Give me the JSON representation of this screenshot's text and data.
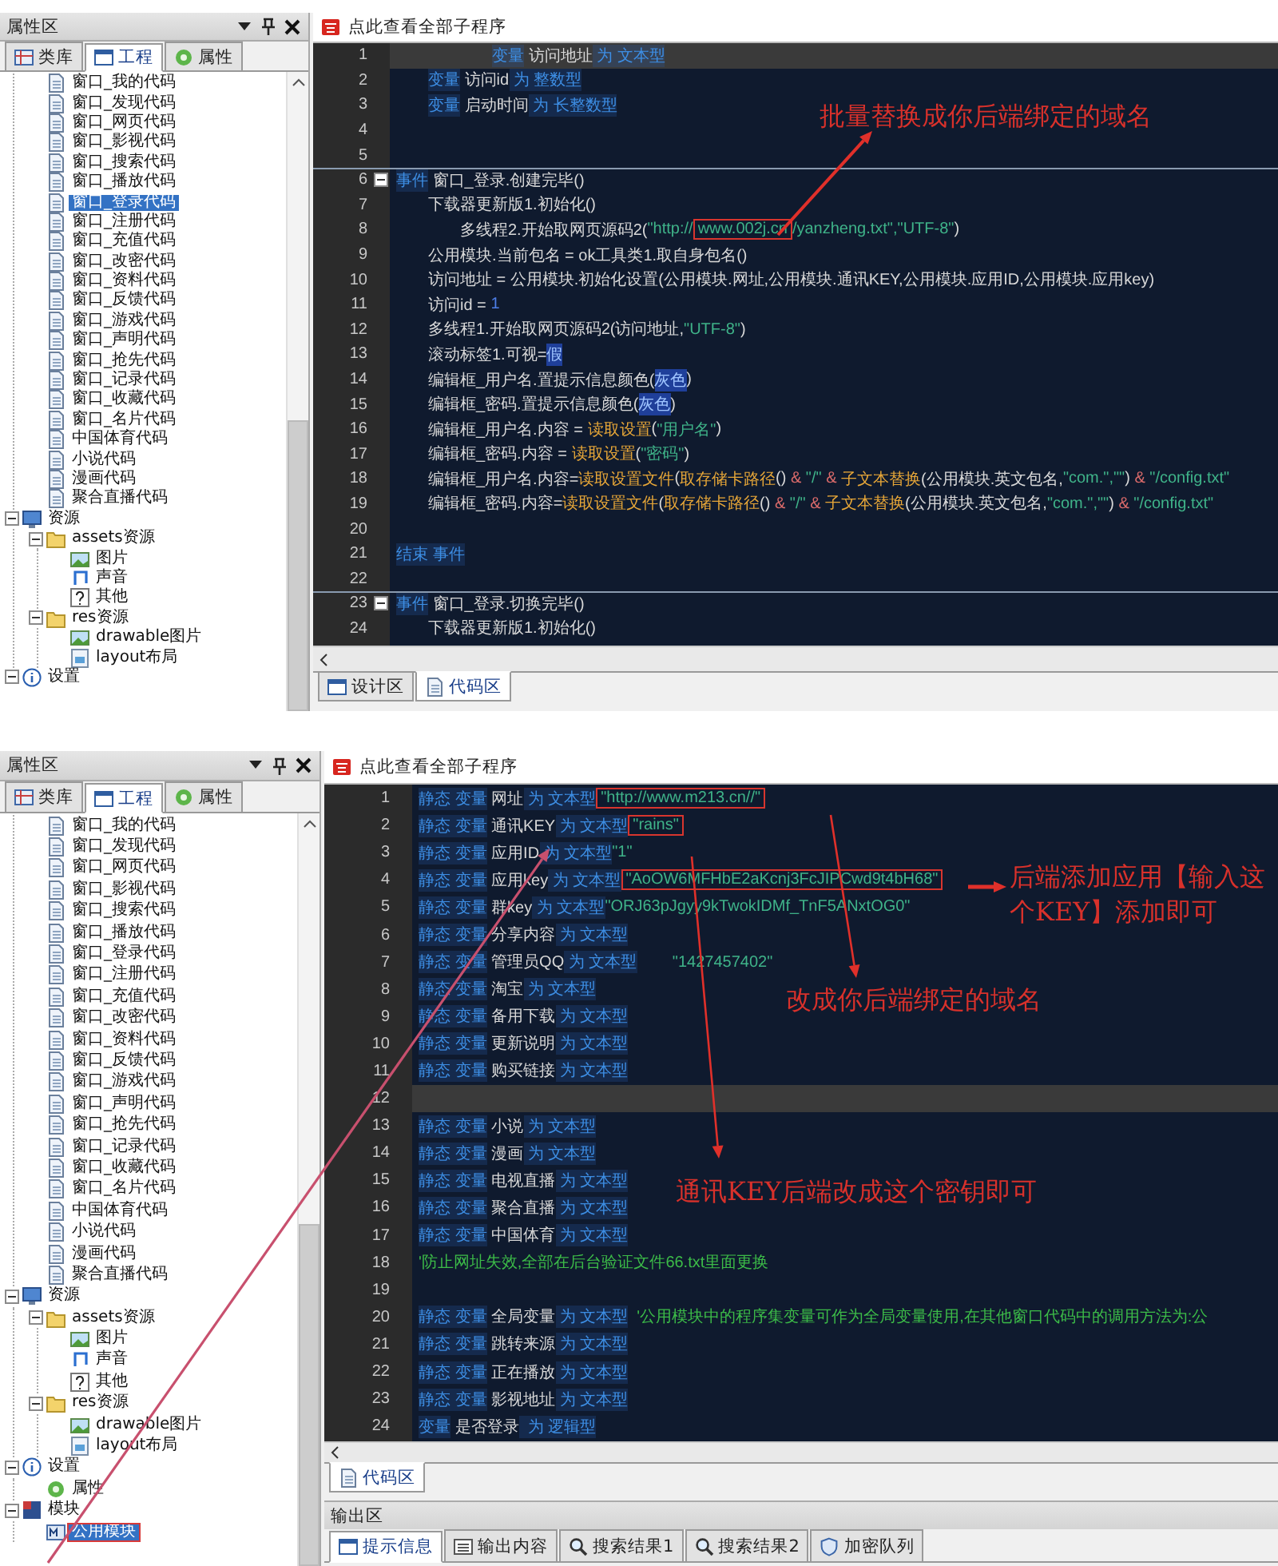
{
  "shots": [
    {
      "sidebar": {
        "title": "属性区",
        "tabs": [
          {
            "label": "类库",
            "kind": "library",
            "selected": false
          },
          {
            "label": "工程",
            "kind": "project",
            "selected": true
          },
          {
            "label": "属性",
            "kind": "property",
            "selected": false
          }
        ],
        "tree": [
          {
            "kind": "continued",
            "children": [
              {
                "label": "窗口_我的代码",
                "kind": "file",
                "selected": false
              },
              {
                "label": "窗口_发现代码",
                "kind": "file",
                "selected": false
              },
              {
                "label": "窗口_网页代码",
                "kind": "file",
                "selected": false
              },
              {
                "label": "窗口_影视代码",
                "kind": "file",
                "selected": false
              },
              {
                "label": "窗口_搜索代码",
                "kind": "file",
                "selected": false
              },
              {
                "label": "窗口_播放代码",
                "kind": "file",
                "selected": false
              },
              {
                "label": "窗口_登录代码",
                "kind": "file",
                "selected": true
              },
              {
                "label": "窗口_注册代码",
                "kind": "file",
                "selected": false
              },
              {
                "label": "窗口_充值代码",
                "kind": "file",
                "selected": false
              },
              {
                "label": "窗口_改密代码",
                "kind": "file",
                "selected": false
              },
              {
                "label": "窗口_资料代码",
                "kind": "file",
                "selected": false
              },
              {
                "label": "窗口_反馈代码",
                "kind": "file",
                "selected": false
              },
              {
                "label": "窗口_游戏代码",
                "kind": "file",
                "selected": false
              },
              {
                "label": "窗口_声明代码",
                "kind": "file",
                "selected": false
              },
              {
                "label": "窗口_抢先代码",
                "kind": "file",
                "selected": false
              },
              {
                "label": "窗口_记录代码",
                "kind": "file",
                "selected": false
              },
              {
                "label": "窗口_收藏代码",
                "kind": "file",
                "selected": false
              },
              {
                "label": "窗口_名片代码",
                "kind": "file",
                "selected": false
              },
              {
                "label": "中国体育代码",
                "kind": "file",
                "selected": false
              },
              {
                "label": "小说代码",
                "kind": "file",
                "selected": false
              },
              {
                "label": "漫画代码",
                "kind": "file",
                "selected": false
              },
              {
                "label": "聚合直播代码",
                "kind": "file",
                "selected": false
              }
            ]
          },
          {
            "label": "资源",
            "kind": "resources",
            "selected": false,
            "expanded": true,
            "children": [
              {
                "label": "assets资源",
                "kind": "folder",
                "selected": false,
                "expanded": true,
                "children": [
                  {
                    "label": "图片",
                    "kind": "image",
                    "selected": false
                  },
                  {
                    "label": "声音",
                    "kind": "sound",
                    "selected": false
                  },
                  {
                    "label": "其他",
                    "kind": "other",
                    "selected": false
                  }
                ]
              },
              {
                "label": "res资源",
                "kind": "folder",
                "selected": false,
                "expanded": true,
                "children": [
                  {
                    "label": "drawable图片",
                    "kind": "image",
                    "selected": false
                  },
                  {
                    "label": "layout布局",
                    "kind": "layout",
                    "selected": false
                  }
                ]
              }
            ]
          },
          {
            "label": "设置",
            "kind": "settings",
            "selected": false,
            "expanded": true
          }
        ]
      },
      "editor": {
        "header": "点此查看全部子程序",
        "lines": [
          {
            "kind": "continued",
            "children": [
              {
                "kind": "continued",
                "children": [
                  {
                    "kind": "continued",
                    "children": [
                      {
                        "n": "1",
                        "current": true,
                        "tokens": [
                          {
                            "kind": "kw",
                            "text": "变量"
                          },
                          {
                            "kind": "id",
                            "text": " 访问地址"
                          },
                          {
                            "kind": "kw",
                            "text": " 为"
                          },
                          {
                            "kind": "kw",
                            "text": " 文本型"
                          }
                        ]
                      }
                    ]
                  }
                ]
              },
              {
                "n": "2",
                "tokens": [
                  {
                    "kind": "kw",
                    "text": "变量"
                  },
                  {
                    "kind": "id",
                    "text": " 访问id"
                  },
                  {
                    "kind": "kw",
                    "text": " 为"
                  },
                  {
                    "kind": "kw",
                    "text": " 整数型"
                  }
                ]
              },
              {
                "n": "3",
                "tokens": [
                  {
                    "kind": "kw",
                    "text": "变量"
                  },
                  {
                    "kind": "id",
                    "text": " 启动时间"
                  },
                  {
                    "kind": "kw",
                    "text": " 为"
                  },
                  {
                    "kind": "kw",
                    "text": " 长整数型"
                  }
                ]
              },
              {
                "n": "4"
              },
              {
                "n": "5"
              }
            ]
          },
          {
            "n": "6",
            "kind": "event",
            "expanded": true,
            "tokens": [
              {
                "kind": "kw",
                "text": "事件"
              },
              {
                "kind": "id",
                "text": " 窗口_登录.创建完毕()"
              }
            ],
            "children": [
              {
                "n": "7",
                "tokens": [
                  {
                    "kind": "id",
                    "text": "下载器更新版1.初始化()"
                  }
                ],
                "children": [
                  {
                    "n": "8",
                    "tokens": [
                      {
                        "kind": "id",
                        "text": "多线程2.开始取网页源码2("
                      },
                      {
                        "kind": "str",
                        "text": "\"http://"
                      },
                      {
                        "kind": "str",
                        "text": "www.002j.cn",
                        "boxed": true
                      },
                      {
                        "kind": "str",
                        "text": "/yanzheng.txt\",\"UTF-8\""
                      },
                      {
                        "kind": "id",
                        "text": ")"
                      }
                    ]
                  }
                ]
              },
              {
                "n": "9",
                "tokens": [
                  {
                    "kind": "id",
                    "text": "公用模块.当前包名 = ok工具类1.取自身包名()"
                  }
                ]
              },
              {
                "n": "10",
                "tokens": [
                  {
                    "kind": "id",
                    "text": "访问地址 = 公用模块.初始化设置(公用模块.网址,公用模块.通讯KEY,公用模块.应用ID,公用模块.应用key)"
                  }
                ]
              },
              {
                "n": "11",
                "tokens": [
                  {
                    "kind": "id",
                    "text": "访问id = "
                  },
                  {
                    "kind": "num",
                    "text": "1"
                  }
                ]
              },
              {
                "n": "12",
                "tokens": [
                  {
                    "kind": "id",
                    "text": "多线程1.开始取网页源码2(访问地址,"
                  },
                  {
                    "kind": "str",
                    "text": "\"UTF-8\""
                  },
                  {
                    "kind": "id",
                    "text": ")"
                  }
                ]
              },
              {
                "n": "13",
                "tokens": [
                  {
                    "kind": "id",
                    "text": "滚动标签1.可视="
                  },
                  {
                    "kind": "const",
                    "text": "假"
                  }
                ]
              },
              {
                "n": "14",
                "tokens": [
                  {
                    "kind": "id",
                    "text": "编辑框_用户名.置提示信息颜色("
                  },
                  {
                    "kind": "const",
                    "text": "灰色"
                  },
                  {
                    "kind": "id",
                    "text": ")"
                  }
                ]
              },
              {
                "n": "15",
                "tokens": [
                  {
                    "kind": "id",
                    "text": "编辑框_密码.置提示信息颜色("
                  },
                  {
                    "kind": "const",
                    "text": "灰色"
                  },
                  {
                    "kind": "id",
                    "text": ")"
                  }
                ]
              },
              {
                "n": "16",
                "tokens": [
                  {
                    "kind": "id",
                    "text": "编辑框_用户名.内容 = "
                  },
                  {
                    "kind": "fn",
                    "text": "读取设置"
                  },
                  {
                    "kind": "id",
                    "text": "("
                  },
                  {
                    "kind": "str",
                    "text": "\"用户名\""
                  },
                  {
                    "kind": "id",
                    "text": ")"
                  }
                ]
              },
              {
                "n": "17",
                "tokens": [
                  {
                    "kind": "id",
                    "text": "编辑框_密码.内容 = "
                  },
                  {
                    "kind": "fn",
                    "text": "读取设置"
                  },
                  {
                    "kind": "id",
                    "text": "("
                  },
                  {
                    "kind": "str",
                    "text": "\"密码\""
                  },
                  {
                    "kind": "id",
                    "text": ")"
                  }
                ]
              },
              {
                "n": "18",
                "tokens": [
                  {
                    "kind": "id",
                    "text": "编辑框_用户名.内容="
                  },
                  {
                    "kind": "fn",
                    "text": "读取设置文件"
                  },
                  {
                    "kind": "id",
                    "text": "("
                  },
                  {
                    "kind": "fn",
                    "text": "取存储卡路径"
                  },
                  {
                    "kind": "id",
                    "text": "() "
                  },
                  {
                    "kind": "op",
                    "text": "&"
                  },
                  {
                    "kind": "str",
                    "text": " \"/\" "
                  },
                  {
                    "kind": "op",
                    "text": "&"
                  },
                  {
                    "kind": "fn",
                    "text": " 子文本替换"
                  },
                  {
                    "kind": "id",
                    "text": "(公用模块.英文包名,"
                  },
                  {
                    "kind": "str",
                    "text": "\"com.\",\"\""
                  },
                  {
                    "kind": "id",
                    "text": ") "
                  },
                  {
                    "kind": "op",
                    "text": "&"
                  },
                  {
                    "kind": "str",
                    "text": " \"/config.txt\""
                  }
                ]
              },
              {
                "n": "19",
                "tokens": [
                  {
                    "kind": "id",
                    "text": "编辑框_密码.内容="
                  },
                  {
                    "kind": "fn",
                    "text": "读取设置文件"
                  },
                  {
                    "kind": "id",
                    "text": "("
                  },
                  {
                    "kind": "fn",
                    "text": "取存储卡路径"
                  },
                  {
                    "kind": "id",
                    "text": "() "
                  },
                  {
                    "kind": "op",
                    "text": "&"
                  },
                  {
                    "kind": "str",
                    "text": " \"/\" "
                  },
                  {
                    "kind": "op",
                    "text": "&"
                  },
                  {
                    "kind": "fn",
                    "text": " 子文本替换"
                  },
                  {
                    "kind": "id",
                    "text": "(公用模块.英文包名,"
                  },
                  {
                    "kind": "str",
                    "text": "\"com.\",\"\""
                  },
                  {
                    "kind": "id",
                    "text": ") "
                  },
                  {
                    "kind": "op",
                    "text": "&"
                  },
                  {
                    "kind": "str",
                    "text": " \"/config.txt\""
                  }
                ]
              },
              {
                "n": "20"
              }
            ]
          },
          {
            "n": "21",
            "tokens": [
              {
                "kind": "kw",
                "text": "结束 事件"
              }
            ]
          },
          {
            "n": "22"
          },
          {
            "n": "23",
            "kind": "event",
            "expanded": true,
            "tokens": [
              {
                "kind": "kw",
                "text": "事件"
              },
              {
                "kind": "id",
                "text": " 窗口_登录.切换完毕()"
              }
            ],
            "children": [
              {
                "n": "24",
                "tokens": [
                  {
                    "kind": "id",
                    "text": "下载器更新版1.初始化()"
                  }
                ]
              }
            ]
          }
        ],
        "tabs": [
          {
            "label": "设计区",
            "kind": "design",
            "selected": false
          },
          {
            "label": "代码区",
            "kind": "code",
            "selected": true
          }
        ]
      },
      "annotations": [
        {
          "text": "批量替换成你后端绑定的域名"
        }
      ]
    },
    {
      "sidebar": {
        "title": "属性区",
        "tabs": [
          {
            "label": "类库",
            "kind": "library",
            "selected": false
          },
          {
            "label": "工程",
            "kind": "project",
            "selected": true
          },
          {
            "label": "属性",
            "kind": "property",
            "selected": false
          }
        ],
        "tree": [
          {
            "kind": "continued",
            "children": [
              {
                "label": "窗口_我的代码",
                "kind": "file",
                "selected": false
              },
              {
                "label": "窗口_发现代码",
                "kind": "file",
                "selected": false
              },
              {
                "label": "窗口_网页代码",
                "kind": "file",
                "selected": false
              },
              {
                "label": "窗口_影视代码",
                "kind": "file",
                "selected": false
              },
              {
                "label": "窗口_搜索代码",
                "kind": "file",
                "selected": false
              },
              {
                "label": "窗口_播放代码",
                "kind": "file",
                "selected": false
              },
              {
                "label": "窗口_登录代码",
                "kind": "file",
                "selected": false
              },
              {
                "label": "窗口_注册代码",
                "kind": "file",
                "selected": false
              },
              {
                "label": "窗口_充值代码",
                "kind": "file",
                "selected": false
              },
              {
                "label": "窗口_改密代码",
                "kind": "file",
                "selected": false
              },
              {
                "label": "窗口_资料代码",
                "kind": "file",
                "selected": false
              },
              {
                "label": "窗口_反馈代码",
                "kind": "file",
                "selected": false
              },
              {
                "label": "窗口_游戏代码",
                "kind": "file",
                "selected": false
              },
              {
                "label": "窗口_声明代码",
                "kind": "file",
                "selected": false
              },
              {
                "label": "窗口_抢先代码",
                "kind": "file",
                "selected": false
              },
              {
                "label": "窗口_记录代码",
                "kind": "file",
                "selected": false
              },
              {
                "label": "窗口_收藏代码",
                "kind": "file",
                "selected": false
              },
              {
                "label": "窗口_名片代码",
                "kind": "file",
                "selected": false
              },
              {
                "label": "中国体育代码",
                "kind": "file",
                "selected": false
              },
              {
                "label": "小说代码",
                "kind": "file",
                "selected": false
              },
              {
                "label": "漫画代码",
                "kind": "file",
                "selected": false
              },
              {
                "label": "聚合直播代码",
                "kind": "file",
                "selected": false
              }
            ]
          },
          {
            "label": "资源",
            "kind": "resources",
            "selected": false,
            "expanded": true,
            "children": [
              {
                "label": "assets资源",
                "kind": "folder",
                "selected": false,
                "expanded": true,
                "children": [
                  {
                    "label": "图片",
                    "kind": "image",
                    "selected": false
                  },
                  {
                    "label": "声音",
                    "kind": "sound",
                    "selected": false
                  },
                  {
                    "label": "其他",
                    "kind": "other",
                    "selected": false
                  }
                ]
              },
              {
                "label": "res资源",
                "kind": "folder",
                "selected": false,
                "expanded": true,
                "children": [
                  {
                    "label": "drawable图片",
                    "kind": "image",
                    "selected": false
                  },
                  {
                    "label": "layout布局",
                    "kind": "layout",
                    "selected": false
                  }
                ]
              }
            ]
          },
          {
            "label": "设置",
            "kind": "settings",
            "selected": false,
            "expanded": true,
            "children": [
              {
                "label": "属性",
                "kind": "property",
                "selected": false
              }
            ]
          },
          {
            "label": "模块",
            "kind": "module",
            "selected": false,
            "expanded": true,
            "children": [
              {
                "label": "公用模块",
                "kind": "source",
                "selected": true,
                "boxed": true
              }
            ]
          }
        ]
      },
      "editor": {
        "header": "点此查看全部子程序",
        "lines": [
          {
            "n": "1",
            "tokens": [
              {
                "kind": "kw",
                "text": "静态"
              },
              {
                "kind": "kw",
                "text": " 变量"
              },
              {
                "kind": "id",
                "text": " 网址"
              },
              {
                "kind": "kw",
                "text": " 为"
              },
              {
                "kind": "kw",
                "text": " 文本型"
              },
              {
                "kind": "str",
                "text": "\"http://www.m213.cn//\"",
                "boxed": true
              }
            ]
          },
          {
            "n": "2",
            "tokens": [
              {
                "kind": "kw",
                "text": "静态"
              },
              {
                "kind": "kw",
                "text": " 变量"
              },
              {
                "kind": "id",
                "text": " 通讯KEY"
              },
              {
                "kind": "kw",
                "text": " 为"
              },
              {
                "kind": "kw",
                "text": " 文本型"
              },
              {
                "kind": "str",
                "text": "\"rains\"",
                "boxed": true
              }
            ]
          },
          {
            "n": "3",
            "tokens": [
              {
                "kind": "kw",
                "text": "静态"
              },
              {
                "kind": "kw",
                "text": " 变量"
              },
              {
                "kind": "id",
                "text": " 应用ID"
              },
              {
                "kind": "kw",
                "text": " 为"
              },
              {
                "kind": "kw",
                "text": " 文本型"
              },
              {
                "kind": "str",
                "text": "\"1\""
              }
            ]
          },
          {
            "n": "4",
            "tokens": [
              {
                "kind": "kw",
                "text": "静态"
              },
              {
                "kind": "kw",
                "text": " 变量"
              },
              {
                "kind": "id",
                "text": " 应用key"
              },
              {
                "kind": "kw",
                "text": " 为"
              },
              {
                "kind": "kw",
                "text": " 文本型"
              },
              {
                "kind": "str",
                "text": "\"AoOW6MFHbE2aKcnj3FcJIPCwd9t4bH68\"",
                "boxed": true
              }
            ]
          },
          {
            "n": "5",
            "tokens": [
              {
                "kind": "kw",
                "text": "静态"
              },
              {
                "kind": "kw",
                "text": " 变量"
              },
              {
                "kind": "id",
                "text": " 群key"
              },
              {
                "kind": "kw",
                "text": " 为"
              },
              {
                "kind": "kw",
                "text": " 文本型"
              },
              {
                "kind": "str",
                "text": "\"ORJ63pJgyy9kTwokIDMf_TnF5ANxtOG0\""
              }
            ]
          },
          {
            "n": "6",
            "tokens": [
              {
                "kind": "kw",
                "text": "静态"
              },
              {
                "kind": "kw",
                "text": " 变量"
              },
              {
                "kind": "id",
                "text": " 分享内容"
              },
              {
                "kind": "kw",
                "text": " 为"
              },
              {
                "kind": "kw",
                "text": " 文本型"
              }
            ]
          },
          {
            "n": "7",
            "tokens": [
              {
                "kind": "kw",
                "text": "静态"
              },
              {
                "kind": "kw",
                "text": " 变量"
              },
              {
                "kind": "id",
                "text": " 管理员QQ"
              },
              {
                "kind": "kw",
                "text": " 为"
              },
              {
                "kind": "kw",
                "text": " 文本型"
              },
              {
                "kind": "str",
                "text": "        \"1427457402\""
              }
            ]
          },
          {
            "n": "8",
            "tokens": [
              {
                "kind": "kw",
                "text": "静态"
              },
              {
                "kind": "kw",
                "text": " 变量"
              },
              {
                "kind": "id",
                "text": " 淘宝"
              },
              {
                "kind": "kw",
                "text": " 为"
              },
              {
                "kind": "kw",
                "text": " 文本型"
              }
            ]
          },
          {
            "n": "9",
            "tokens": [
              {
                "kind": "kw",
                "text": "静态"
              },
              {
                "kind": "kw",
                "text": " 变量"
              },
              {
                "kind": "id",
                "text": " 备用下载"
              },
              {
                "kind": "kw",
                "text": " 为"
              },
              {
                "kind": "kw",
                "text": " 文本型"
              }
            ]
          },
          {
            "n": "10",
            "tokens": [
              {
                "kind": "kw",
                "text": "静态"
              },
              {
                "kind": "kw",
                "text": " 变量"
              },
              {
                "kind": "id",
                "text": " 更新说明"
              },
              {
                "kind": "kw",
                "text": " 为"
              },
              {
                "kind": "kw",
                "text": " 文本型"
              }
            ]
          },
          {
            "n": "11",
            "tokens": [
              {
                "kind": "kw",
                "text": "静态"
              },
              {
                "kind": "kw",
                "text": " 变量"
              },
              {
                "kind": "id",
                "text": " 购买链接"
              },
              {
                "kind": "kw",
                "text": " 为"
              },
              {
                "kind": "kw",
                "text": " 文本型"
              }
            ]
          },
          {
            "n": "12",
            "current": true
          },
          {
            "n": "13",
            "tokens": [
              {
                "kind": "kw",
                "text": "静态"
              },
              {
                "kind": "kw",
                "text": " 变量"
              },
              {
                "kind": "id",
                "text": " 小说"
              },
              {
                "kind": "kw",
                "text": " 为"
              },
              {
                "kind": "kw",
                "text": " 文本型"
              }
            ]
          },
          {
            "n": "14",
            "tokens": [
              {
                "kind": "kw",
                "text": "静态"
              },
              {
                "kind": "kw",
                "text": " 变量"
              },
              {
                "kind": "id",
                "text": " 漫画"
              },
              {
                "kind": "kw",
                "text": " 为"
              },
              {
                "kind": "kw",
                "text": " 文本型"
              }
            ]
          },
          {
            "n": "15",
            "tokens": [
              {
                "kind": "kw",
                "text": "静态"
              },
              {
                "kind": "kw",
                "text": " 变量"
              },
              {
                "kind": "id",
                "text": " 电视直播"
              },
              {
                "kind": "kw",
                "text": " 为"
              },
              {
                "kind": "kw",
                "text": " 文本型"
              }
            ]
          },
          {
            "n": "16",
            "tokens": [
              {
                "kind": "kw",
                "text": "静态"
              },
              {
                "kind": "kw",
                "text": " 变量"
              },
              {
                "kind": "id",
                "text": " 聚合直播"
              },
              {
                "kind": "kw",
                "text": " 为"
              },
              {
                "kind": "kw",
                "text": " 文本型"
              }
            ]
          },
          {
            "n": "17",
            "tokens": [
              {
                "kind": "kw",
                "text": "静态"
              },
              {
                "kind": "kw",
                "text": " 变量"
              },
              {
                "kind": "id",
                "text": " 中国体育"
              },
              {
                "kind": "kw",
                "text": " 为"
              },
              {
                "kind": "kw",
                "text": " 文本型"
              }
            ]
          },
          {
            "n": "18",
            "tokens": [
              {
                "kind": "cm",
                "text": "'防止网址失效,全部在后台验证文件66.txt里面更换"
              }
            ]
          },
          {
            "n": "19"
          },
          {
            "n": "20",
            "tokens": [
              {
                "kind": "kw",
                "text": "静态"
              },
              {
                "kind": "kw",
                "text": " 变量"
              },
              {
                "kind": "id",
                "text": " 全局变量"
              },
              {
                "kind": "kw",
                "text": " 为"
              },
              {
                "kind": "kw",
                "text": " 文本型"
              },
              {
                "kind": "cm",
                "text": "  '公用模块中的程序集变量可作为全局变量使用,在其他窗口代码中的调用方法为:公"
              }
            ]
          },
          {
            "n": "21",
            "tokens": [
              {
                "kind": "kw",
                "text": "静态"
              },
              {
                "kind": "kw",
                "text": " 变量"
              },
              {
                "kind": "id",
                "text": " 跳转来源"
              },
              {
                "kind": "kw",
                "text": " 为"
              },
              {
                "kind": "kw",
                "text": " 文本型"
              }
            ]
          },
          {
            "n": "22",
            "tokens": [
              {
                "kind": "kw",
                "text": "静态"
              },
              {
                "kind": "kw",
                "text": " 变量"
              },
              {
                "kind": "id",
                "text": " 正在播放"
              },
              {
                "kind": "kw",
                "text": " 为"
              },
              {
                "kind": "kw",
                "text": " 文本型"
              }
            ]
          },
          {
            "n": "23",
            "tokens": [
              {
                "kind": "kw",
                "text": "静态"
              },
              {
                "kind": "kw",
                "text": " 变量"
              },
              {
                "kind": "id",
                "text": " 影视地址"
              },
              {
                "kind": "kw",
                "text": " 为"
              },
              {
                "kind": "kw",
                "text": " 文本型"
              }
            ]
          },
          {
            "n": "24",
            "tokens": [
              {
                "kind": "kw",
                "text": "变量"
              },
              {
                "kind": "id",
                "text": " 是否登录"
              },
              {
                "kind": "kw",
                "text": "  为"
              },
              {
                "kind": "kw",
                "text": " 逻辑型"
              }
            ]
          }
        ],
        "tabs": [
          {
            "label": "代码区",
            "kind": "code",
            "selected": true
          }
        ]
      },
      "output": {
        "title": "输出区",
        "tabs": [
          {
            "label": "提示信息",
            "kind": "hints",
            "selected": true
          },
          {
            "label": "输出内容",
            "kind": "output",
            "selected": false
          },
          {
            "label": "搜索结果1",
            "kind": "search",
            "selected": false
          },
          {
            "label": "搜索结果2",
            "kind": "search",
            "selected": false
          },
          {
            "label": "加密队列",
            "kind": "encrypt",
            "selected": false
          }
        ]
      },
      "annotations": [
        {
          "text": "后端添加应用【输入这个KEY】添加即可"
        },
        {
          "text": "改成你后端绑定的域名"
        },
        {
          "text": "通讯KEY后端改成这个密钥即可"
        }
      ]
    }
  ]
}
